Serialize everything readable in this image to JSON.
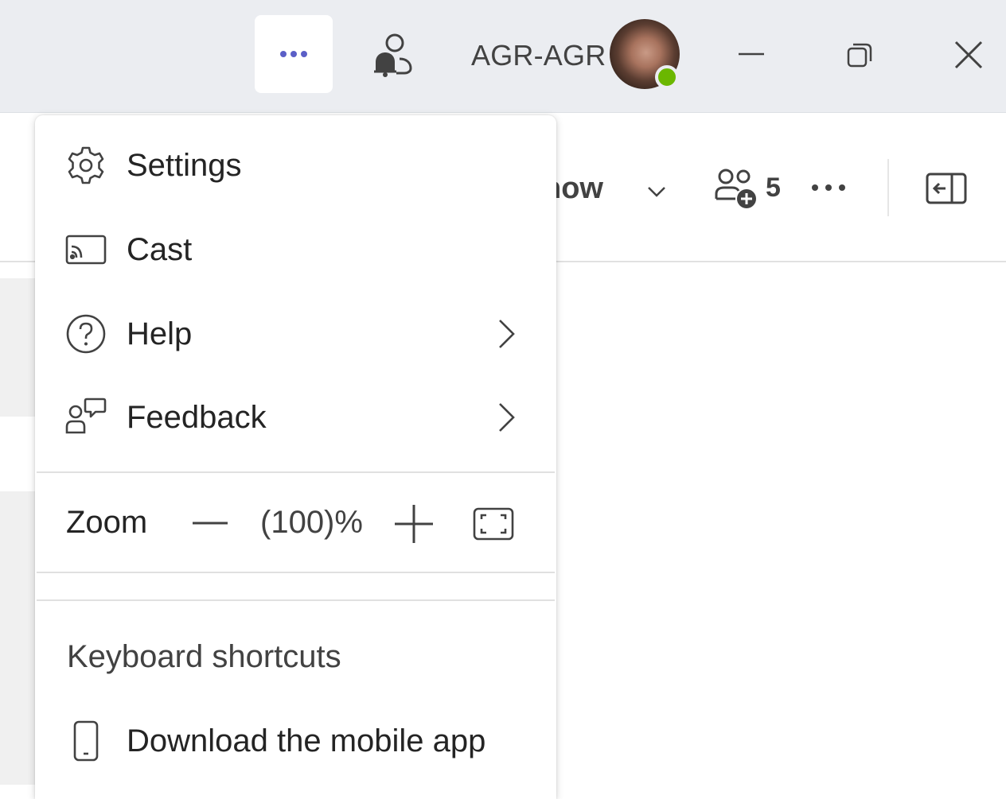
{
  "titlebar": {
    "more_icon": "more-horizontal-icon",
    "activity_icon": "person-bell-icon",
    "user_name": "AGR-AGR",
    "presence_color": "#6bb700",
    "minimize_icon": "minimize-icon",
    "restore_icon": "restore-icon",
    "close_icon": "close-icon"
  },
  "background": {
    "meet_label_partial": "now",
    "participants_count": "5",
    "accent": "#5b5fc7"
  },
  "menu": {
    "items": [
      {
        "label": "Settings",
        "icon": "gear-icon"
      },
      {
        "label": "Cast",
        "icon": "cast-icon"
      },
      {
        "label": "Help",
        "icon": "help-circle-icon",
        "has_submenu": true
      },
      {
        "label": "Feedback",
        "icon": "person-feedback-icon",
        "has_submenu": true
      }
    ],
    "zoom": {
      "label": "Zoom",
      "value": "(100)%",
      "decrease_icon": "minus-icon",
      "increase_icon": "plus-icon",
      "fullscreen_icon": "fullscreen-icon"
    },
    "keyboard_shortcuts": "Keyboard shortcuts",
    "download_app": {
      "label": "Download the mobile app",
      "icon": "phone-icon"
    }
  }
}
